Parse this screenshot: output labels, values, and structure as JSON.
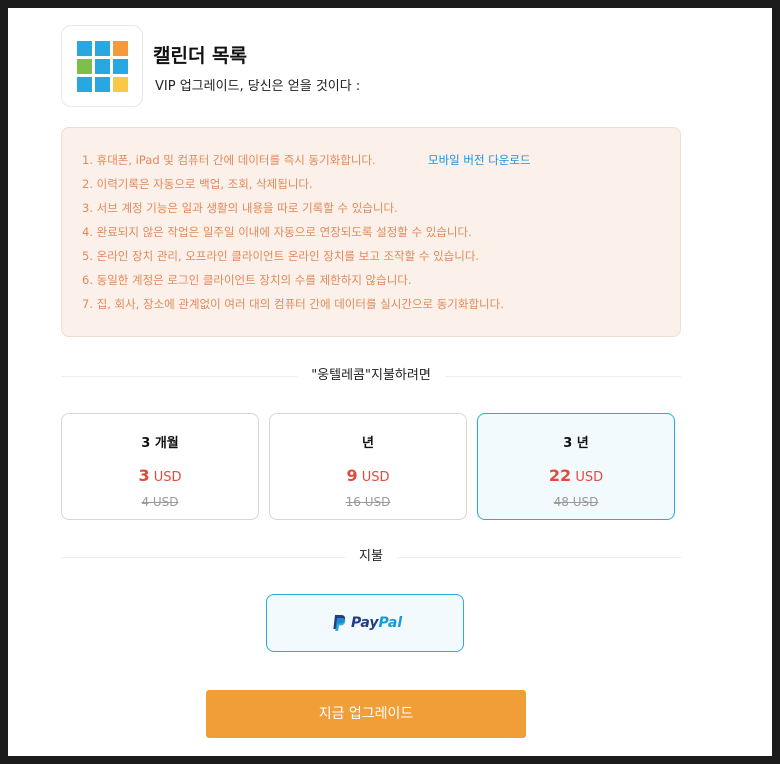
{
  "header": {
    "title": "캘린더 목록",
    "subtitle": "VIP 업그레이드, 당신은 얻을 것이다 :"
  },
  "features": {
    "items": [
      "1. 휴대폰, iPad 및 컴퓨터 간에 데이터를 즉시 동기화합니다.",
      "2. 이력기록은 자동으로 백업, 조회, 삭제됩니다.",
      "3. 서브 계정 기능은 일과 생활의 내용을 따로 기록할 수 있습니다.",
      "4. 완료되지 않은 작업은 일주일 이내에 자동으로 연장되도록 설정할 수 있습니다.",
      "5. 온라인 장치 관리, 오프라인 클라이언트 온라인 장치를 보고 조작할 수 있습니다.",
      "6. 동일한 계정은 로그인 클라이언트 장치의 수를 제한하지 않습니다.",
      "7. 집, 회사, 장소에 관계없이 여러 대의 컴퓨터 간에 데이터를 실시간으로 동기화합니다."
    ],
    "mobile_link": "모바일 버전 다운로드"
  },
  "plan_section": {
    "label": "\"웅텔레콤\"지불하려면"
  },
  "plans": [
    {
      "name": "3 개월",
      "price": "3",
      "currency": "USD",
      "original": "4 USD",
      "selected": false
    },
    {
      "name": "년",
      "price": "9",
      "currency": "USD",
      "original": "16 USD",
      "selected": false
    },
    {
      "name": "3 년",
      "price": "22",
      "currency": "USD",
      "original": "48 USD",
      "selected": true
    }
  ],
  "payment_section": {
    "label": "지불"
  },
  "payment": {
    "paypal_a": "Pay",
    "paypal_b": "Pal",
    "icon": "paypal-logo"
  },
  "upgrade_button": {
    "label": "지금 업그레이드"
  },
  "colors": {
    "accent": "#f09e38",
    "selected_border": "#29aed6",
    "price": "#e14b3b",
    "feature_text": "#e08a5a",
    "link": "#1e90d6"
  },
  "app_icon": {
    "name": "calendar-grid-icon",
    "tiles": [
      "#29a7e1",
      "#29a7e1",
      "#f39a3c",
      "#7cbf4a",
      "#29a7e1",
      "#29a7e1",
      "#29a7e1",
      "#29a7e1",
      "#f9c845"
    ]
  }
}
